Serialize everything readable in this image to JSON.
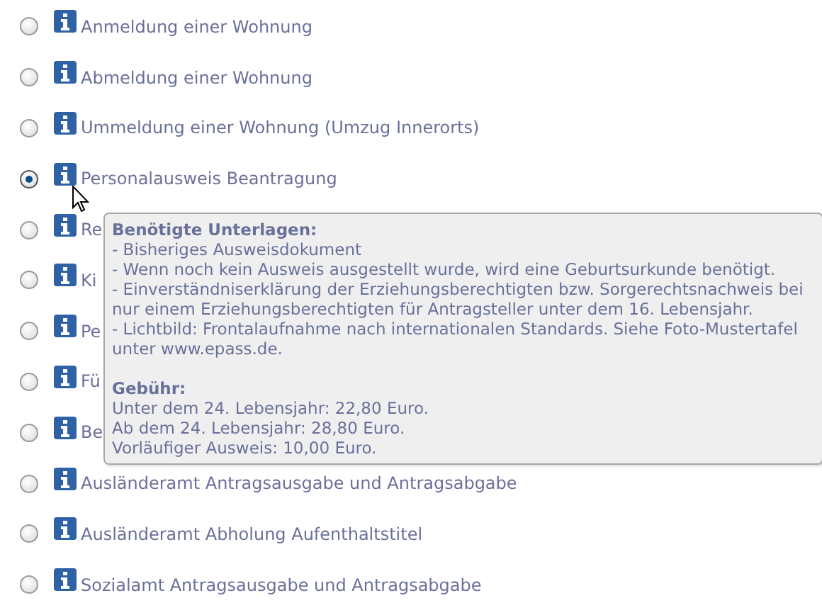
{
  "options": [
    {
      "label": "Anmeldung einer Wohnung",
      "selected": false
    },
    {
      "label": "Abmeldung einer Wohnung",
      "selected": false
    },
    {
      "label": "Ummeldung einer Wohnung (Umzug Innerorts)",
      "selected": false
    },
    {
      "label": "Personalausweis Beantragung",
      "selected": true
    },
    {
      "label": "Re",
      "selected": false
    },
    {
      "label": "Ki",
      "selected": false
    },
    {
      "label": "Pe",
      "selected": false
    },
    {
      "label": "Fü",
      "selected": false
    },
    {
      "label": "Be",
      "selected": false
    },
    {
      "label": "Ausländeramt Antragsausgabe und Antragsabgabe",
      "selected": false
    },
    {
      "label": "Ausländeramt Abholung Aufenthaltstitel",
      "selected": false
    },
    {
      "label": "Sozialamt Antragsausgabe und Antragsabgabe",
      "selected": false
    }
  ],
  "tooltip": {
    "heading": "Benötigte Unterlagen:",
    "items": [
      "- Bisheriges Ausweisdokument",
      "- Wenn noch kein Ausweis ausgestellt wurde, wird eine Geburtsurkunde benötigt.",
      "- Einverständniserklärung der Erziehungsberechtigten bzw. Sorgerechtsnachweis bei nur einem Erziehungsberechtigten für Antragsteller unter dem 16. Lebensjahr.",
      "- Lichtbild: Frontalaufnahme nach internationalen Standards. Siehe Foto-Mustertafel unter www.epass.de."
    ],
    "fee_heading": "Gebühr:",
    "fees": [
      "Unter dem 24. Lebensjahr: 22,80 Euro.",
      "Ab dem 24. Lebensjahr: 28,80 Euro.",
      "Vorläufiger Ausweis: 10,00 Euro."
    ]
  }
}
